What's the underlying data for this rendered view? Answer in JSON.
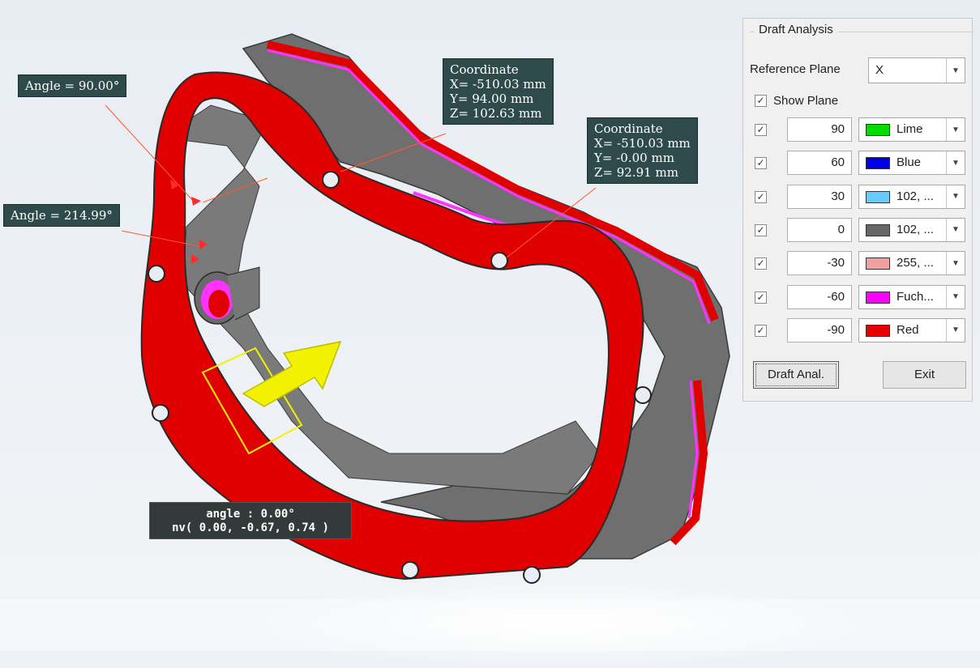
{
  "callouts": {
    "angle_top": "Angle = 90.00°",
    "angle_left": "Angle = 214.99°",
    "coord_1": {
      "title": "Coordinate",
      "x": "X= -510.03 mm",
      "y": "Y= 94.00 mm",
      "z": "Z= 102.63 mm"
    },
    "coord_2": {
      "title": "Coordinate",
      "x": "X= -510.03 mm",
      "y": "Y= -0.00 mm",
      "z": "Z= 92.91 mm"
    },
    "angle_info": {
      "line1": "angle : 0.00°",
      "line2": "nv( 0.00, -0.67, 0.74 )"
    }
  },
  "panel": {
    "title": "Draft Analysis",
    "reference_plane_label": "Reference Plane",
    "reference_plane_value": "X",
    "show_plane_label": "Show Plane",
    "show_plane_checked": true,
    "rows": [
      {
        "value": "90",
        "color_name": "Lime",
        "swatch": "#00dd00",
        "checked": true
      },
      {
        "value": "60",
        "color_name": "Blue",
        "swatch": "#0000e6",
        "checked": true
      },
      {
        "value": "30",
        "color_name": "102, ...",
        "swatch": "#66ccff",
        "checked": true
      },
      {
        "value": "0",
        "color_name": "102, ...",
        "swatch": "#666666",
        "checked": true
      },
      {
        "value": "-30",
        "color_name": "255, ...",
        "swatch": "#f0a0a0",
        "checked": true
      },
      {
        "value": "-60",
        "color_name": "Fuch...",
        "swatch": "#ff00ff",
        "checked": true
      },
      {
        "value": "-90",
        "color_name": "Red",
        "swatch": "#e60000",
        "checked": true
      }
    ],
    "draft_button": "Draft Anal.",
    "exit_button": "Exit"
  },
  "colors": {
    "part_face": "#e00000",
    "part_wall": "#6f6f6f",
    "part_wall_dark": "#4f4f4f",
    "fuchsia": "#ff33ff",
    "arrow": "#f2f200",
    "callout_bg": "#2e4a4a"
  }
}
